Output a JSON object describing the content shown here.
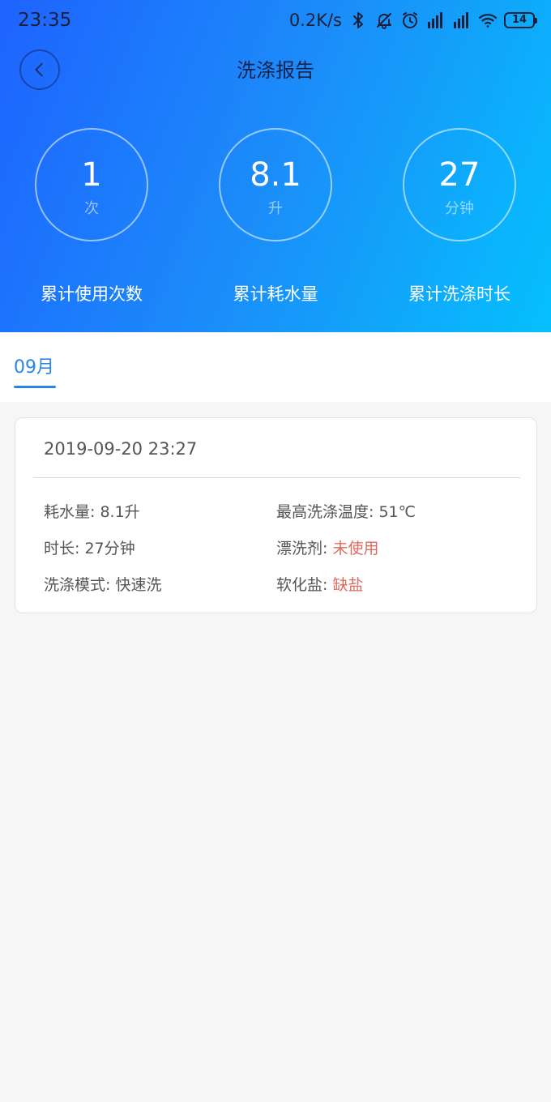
{
  "status_bar": {
    "time": "23:35",
    "net_speed": "0.2K/s",
    "battery": "14",
    "icons": [
      "bluetooth-icon",
      "mute-icon",
      "alarm-icon",
      "signal-hd-icon",
      "signal-icon",
      "wifi-icon",
      "battery-icon"
    ]
  },
  "header": {
    "title": "洗涤报告",
    "back_icon": "chevron-left-icon"
  },
  "stats": [
    {
      "value": "1",
      "unit": "次",
      "label": "累计使用次数"
    },
    {
      "value": "8.1",
      "unit": "升",
      "label": "累计耗水量"
    },
    {
      "value": "27",
      "unit": "分钟",
      "label": "累计洗涤时长"
    }
  ],
  "month_tab": {
    "label": "09月"
  },
  "records": [
    {
      "datetime": "2019-09-20 23:27",
      "water_label": "耗水量: ",
      "water_value": "8.1升",
      "temp_label": "最高洗涤温度: ",
      "temp_value": "51℃",
      "duration_label": "时长: ",
      "duration_value": "27分钟",
      "rinse_label": "漂洗剂: ",
      "rinse_value": "未使用",
      "mode_label": "洗涤模式: ",
      "mode_value": "快速洗",
      "salt_label": "软化盐: ",
      "salt_value": "缺盐"
    }
  ],
  "colors": {
    "gradient_start": "#1e63ff",
    "gradient_end": "#05c0fd",
    "accent": "#2a86e6",
    "warning": "#e06a5c"
  }
}
